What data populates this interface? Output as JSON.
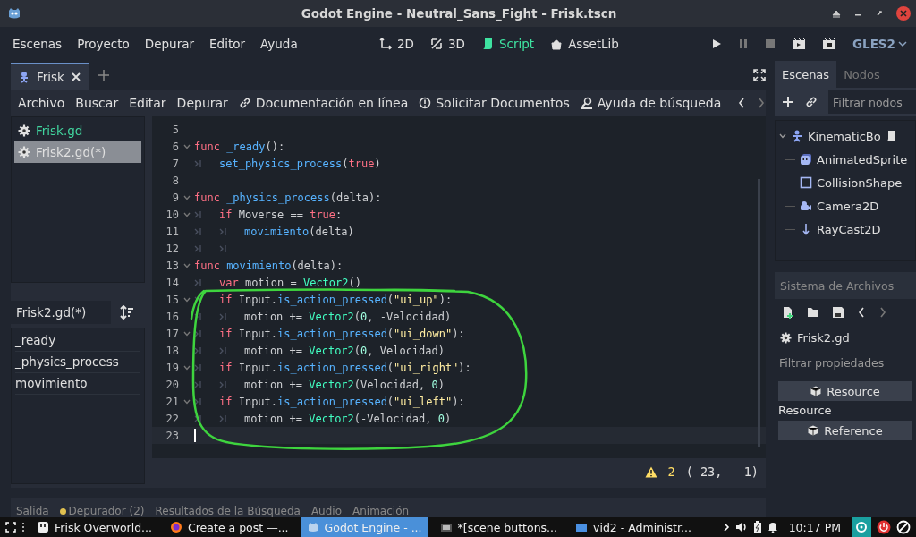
{
  "window": {
    "title": "Godot Engine - Neutral_Sans_Fight - Frisk.tscn"
  },
  "menus": [
    "Escenas",
    "Proyecto",
    "Depurar",
    "Editor",
    "Ayuda"
  ],
  "workspaces": [
    {
      "label": "2D",
      "selected": false
    },
    {
      "label": "3D",
      "selected": false
    },
    {
      "label": "Script",
      "selected": true
    },
    {
      "label": "AssetLib",
      "selected": false
    }
  ],
  "renderer": "GLES2",
  "scene_tabs": [
    {
      "label": "Frisk",
      "selected": true
    }
  ],
  "script_menu": [
    "Archivo",
    "Buscar",
    "Editar",
    "Depurar"
  ],
  "script_links": [
    "Documentación en línea",
    "Solicitar Documentos",
    "Ayuda de búsqueda"
  ],
  "scripts": [
    {
      "label": "Frisk.gd",
      "selected": false,
      "color": "#41d49e"
    },
    {
      "label": "Frisk2.gd(*)",
      "selected": true,
      "color": "#e0e0e0"
    }
  ],
  "script_filter": {
    "value": "Frisk2.gd(*)"
  },
  "methods": [
    "_ready",
    "_physics_process",
    "movimiento"
  ],
  "code": [
    {
      "number": "5",
      "foldable": false,
      "current": false
    },
    {
      "number": "6",
      "foldable": true,
      "current": false,
      "tokens": [
        {
          "kind": "kw",
          "text": "func "
        },
        {
          "kind": "fn",
          "text": "_ready"
        },
        {
          "kind": "plain",
          "text": "():"
        }
      ]
    },
    {
      "number": "7",
      "foldable": false,
      "current": false,
      "tokens": [
        {
          "kind": "tab"
        },
        {
          "kind": "fn",
          "text": "set_physics_process"
        },
        {
          "kind": "plain",
          "text": "("
        },
        {
          "kind": "kw",
          "text": "true"
        },
        {
          "kind": "plain",
          "text": ")"
        }
      ]
    },
    {
      "number": "8",
      "foldable": false,
      "current": false
    },
    {
      "number": "9",
      "foldable": true,
      "current": false,
      "tokens": [
        {
          "kind": "kw",
          "text": "func "
        },
        {
          "kind": "fn",
          "text": "_physics_process"
        },
        {
          "kind": "plain",
          "text": "(delta):"
        }
      ]
    },
    {
      "number": "10",
      "foldable": true,
      "current": false,
      "tokens": [
        {
          "kind": "tab"
        },
        {
          "kind": "kw",
          "text": "if"
        },
        {
          "kind": "plain",
          "text": " Moverse == "
        },
        {
          "kind": "kw",
          "text": "true"
        },
        {
          "kind": "plain",
          "text": ":"
        }
      ]
    },
    {
      "number": "11",
      "foldable": false,
      "current": false,
      "tokens": [
        {
          "kind": "tab"
        },
        {
          "kind": "tab"
        },
        {
          "kind": "fn",
          "text": "movimiento"
        },
        {
          "kind": "plain",
          "text": "(delta)"
        }
      ]
    },
    {
      "number": "12",
      "foldable": false,
      "current": false,
      "tokens": [
        {
          "kind": "tab"
        },
        {
          "kind": "tab"
        }
      ]
    },
    {
      "number": "13",
      "foldable": true,
      "current": false,
      "tokens": [
        {
          "kind": "kw",
          "text": "func "
        },
        {
          "kind": "fn",
          "text": "movimiento"
        },
        {
          "kind": "plain",
          "text": "(delta):"
        }
      ]
    },
    {
      "number": "14",
      "foldable": false,
      "current": false,
      "tokens": [
        {
          "kind": "tab"
        },
        {
          "kind": "kw",
          "text": "var"
        },
        {
          "kind": "plain",
          "text": " motion = "
        },
        {
          "kind": "class",
          "text": "Vector2"
        },
        {
          "kind": "plain",
          "text": "()"
        }
      ]
    },
    {
      "number": "15",
      "foldable": true,
      "current": false,
      "tokens": [
        {
          "kind": "tab"
        },
        {
          "kind": "kw",
          "text": "if"
        },
        {
          "kind": "plain",
          "text": " Input."
        },
        {
          "kind": "fn",
          "text": "is_action_pressed"
        },
        {
          "kind": "plain",
          "text": "("
        },
        {
          "kind": "str",
          "text": "\"ui_up\""
        },
        {
          "kind": "plain",
          "text": "):"
        }
      ]
    },
    {
      "number": "16",
      "foldable": false,
      "current": false,
      "tokens": [
        {
          "kind": "tab"
        },
        {
          "kind": "tab"
        },
        {
          "kind": "plain",
          "text": "motion += "
        },
        {
          "kind": "class",
          "text": "Vector2"
        },
        {
          "kind": "plain",
          "text": "("
        },
        {
          "kind": "num",
          "text": "0"
        },
        {
          "kind": "plain",
          "text": ", -Velocidad)"
        }
      ]
    },
    {
      "number": "17",
      "foldable": true,
      "current": false,
      "tokens": [
        {
          "kind": "tab"
        },
        {
          "kind": "kw",
          "text": "if"
        },
        {
          "kind": "plain",
          "text": " Input."
        },
        {
          "kind": "fn",
          "text": "is_action_pressed"
        },
        {
          "kind": "plain",
          "text": "("
        },
        {
          "kind": "str",
          "text": "\"ui_down\""
        },
        {
          "kind": "plain",
          "text": "):"
        }
      ]
    },
    {
      "number": "18",
      "foldable": false,
      "current": false,
      "tokens": [
        {
          "kind": "tab"
        },
        {
          "kind": "tab"
        },
        {
          "kind": "plain",
          "text": "motion += "
        },
        {
          "kind": "class",
          "text": "Vector2"
        },
        {
          "kind": "plain",
          "text": "("
        },
        {
          "kind": "num",
          "text": "0"
        },
        {
          "kind": "plain",
          "text": ", Velocidad)"
        }
      ]
    },
    {
      "number": "19",
      "foldable": true,
      "current": false,
      "tokens": [
        {
          "kind": "tab"
        },
        {
          "kind": "kw",
          "text": "if"
        },
        {
          "kind": "plain",
          "text": " Input."
        },
        {
          "kind": "fn",
          "text": "is_action_pressed"
        },
        {
          "kind": "plain",
          "text": "("
        },
        {
          "kind": "str",
          "text": "\"ui_right\""
        },
        {
          "kind": "plain",
          "text": "):"
        }
      ]
    },
    {
      "number": "20",
      "foldable": false,
      "current": false,
      "tokens": [
        {
          "kind": "tab"
        },
        {
          "kind": "tab"
        },
        {
          "kind": "plain",
          "text": "motion += "
        },
        {
          "kind": "class",
          "text": "Vector2"
        },
        {
          "kind": "plain",
          "text": "(Velocidad, "
        },
        {
          "kind": "num",
          "text": "0"
        },
        {
          "kind": "plain",
          "text": ")"
        }
      ]
    },
    {
      "number": "21",
      "foldable": true,
      "current": false,
      "tokens": [
        {
          "kind": "tab"
        },
        {
          "kind": "kw",
          "text": "if"
        },
        {
          "kind": "plain",
          "text": " Input."
        },
        {
          "kind": "fn",
          "text": "is_action_pressed"
        },
        {
          "kind": "plain",
          "text": "("
        },
        {
          "kind": "str",
          "text": "\"ui_left\""
        },
        {
          "kind": "plain",
          "text": "):"
        }
      ]
    },
    {
      "number": "22",
      "foldable": false,
      "current": false,
      "tokens": [
        {
          "kind": "tab"
        },
        {
          "kind": "tab"
        },
        {
          "kind": "plain",
          "text": "motion += "
        },
        {
          "kind": "class",
          "text": "Vector2"
        },
        {
          "kind": "plain",
          "text": "(-Velocidad, "
        },
        {
          "kind": "num",
          "text": "0"
        },
        {
          "kind": "plain",
          "text": ")"
        }
      ]
    },
    {
      "number": "23",
      "foldable": false,
      "current": true
    }
  ],
  "annotation": {
    "kind": "freehand",
    "color": "#3ed43e"
  },
  "status": {
    "warnings": "2",
    "position": "( 23,   1)"
  },
  "bottom_tabs": [
    {
      "label": "Salida",
      "dot": false
    },
    {
      "label": "Depurador (2)",
      "dot": true
    },
    {
      "label": "Resultados de la Búsqueda",
      "dot": false
    },
    {
      "label": "Audio",
      "dot": false
    },
    {
      "label": "Animación",
      "dot": false
    }
  ],
  "dock_tabs": [
    {
      "label": "Escenas",
      "selected": true
    },
    {
      "label": "Nodos",
      "selected": false
    }
  ],
  "node_filter": {
    "placeholder": "Filtrar nodos"
  },
  "tree": [
    {
      "label": "KinematicBo",
      "kind": "body",
      "script": true,
      "expanded": true,
      "children": [
        {
          "label": "AnimatedSprite",
          "kind": "sprite",
          "script": false
        },
        {
          "label": "CollisionShape",
          "kind": "shape",
          "script": false
        },
        {
          "label": "Camera2D",
          "kind": "camera",
          "script": false
        },
        {
          "label": "RayCast2D",
          "kind": "ray",
          "script": false
        }
      ]
    }
  ],
  "filesystem": {
    "title": "Sistema de Archivos"
  },
  "inspector": {
    "resource": "Frisk2.gd",
    "filter": {
      "placeholder": "Filtrar propiedades"
    },
    "rows": [
      {
        "kind": "category",
        "text": "Resource"
      },
      {
        "kind": "label",
        "text": "Resource"
      },
      {
        "kind": "category",
        "text": "Reference"
      }
    ]
  },
  "taskbar": {
    "items": [
      {
        "label": "Frisk Overworld...",
        "selected": false
      },
      {
        "label": "Create a post —...",
        "selected": false
      },
      {
        "label": "Godot Engine - ...",
        "selected": true
      },
      {
        "label": "*[scene buttons...",
        "selected": false
      },
      {
        "label": "vid2 - Administr...",
        "selected": false
      }
    ],
    "clock": "10:17 PM"
  }
}
